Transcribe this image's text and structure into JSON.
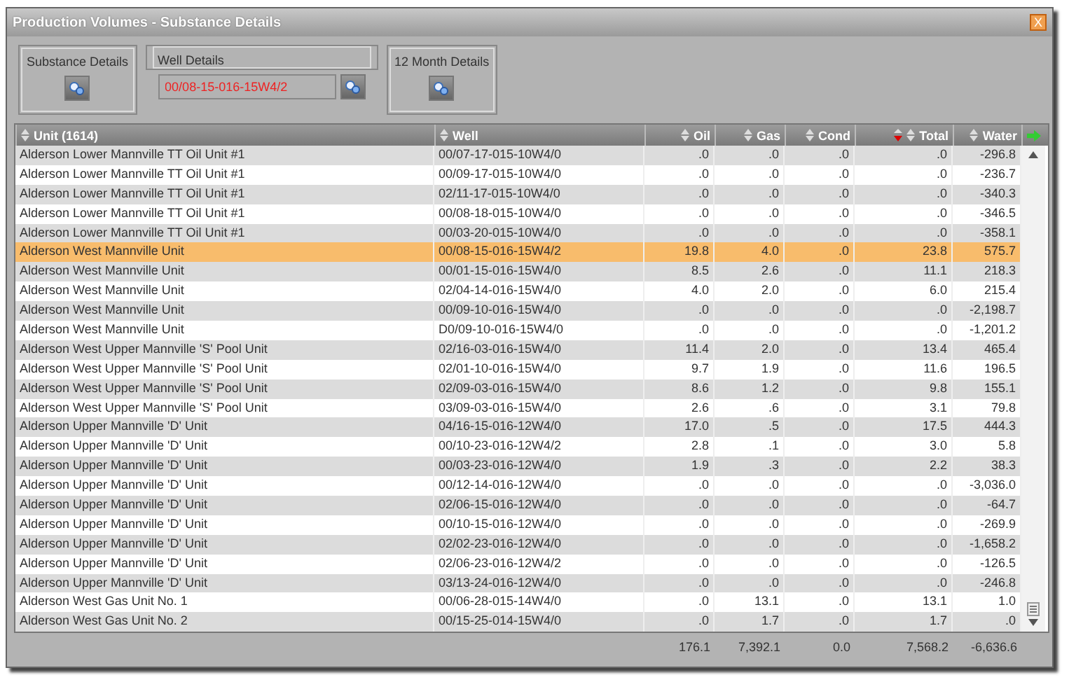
{
  "window": {
    "title": "Production Volumes - Substance Details",
    "close_label": "X"
  },
  "panels": [
    {
      "kind": "button",
      "title": "Substance Details"
    },
    {
      "kind": "field",
      "title": "Well Details",
      "value": "00/08-15-016-15W4/2"
    },
    {
      "kind": "button",
      "title": "12 Month Details"
    }
  ],
  "table": {
    "columns": [
      {
        "label": "Unit (1614)",
        "sorted": false
      },
      {
        "label": "Well",
        "sorted": false
      },
      {
        "label": "Oil",
        "sorted": false
      },
      {
        "label": "Gas",
        "sorted": false
      },
      {
        "label": "Cond",
        "sorted": false
      },
      {
        "label": "Total",
        "sorted": true
      },
      {
        "label": "Water",
        "sorted": false
      }
    ],
    "rows": [
      {
        "cells": [
          "Alderson Lower Mannville TT Oil Unit #1",
          "00/07-17-015-10W4/0",
          ".0",
          ".0",
          ".0",
          ".0",
          "-296.8"
        ],
        "selected": false
      },
      {
        "cells": [
          "Alderson Lower Mannville TT Oil Unit #1",
          "00/09-17-015-10W4/0",
          ".0",
          ".0",
          ".0",
          ".0",
          "-236.7"
        ],
        "selected": false
      },
      {
        "cells": [
          "Alderson Lower Mannville TT Oil Unit #1",
          "02/11-17-015-10W4/0",
          ".0",
          ".0",
          ".0",
          ".0",
          "-340.3"
        ],
        "selected": false
      },
      {
        "cells": [
          "Alderson Lower Mannville TT Oil Unit #1",
          "00/08-18-015-10W4/0",
          ".0",
          ".0",
          ".0",
          ".0",
          "-346.5"
        ],
        "selected": false
      },
      {
        "cells": [
          "Alderson Lower Mannville TT Oil Unit #1",
          "00/03-20-015-10W4/0",
          ".0",
          ".0",
          ".0",
          ".0",
          "-358.1"
        ],
        "selected": false
      },
      {
        "cells": [
          "Alderson West Mannville Unit",
          "00/08-15-016-15W4/2",
          "19.8",
          "4.0",
          ".0",
          "23.8",
          "575.7"
        ],
        "selected": true
      },
      {
        "cells": [
          "Alderson West Mannville Unit",
          "00/01-15-016-15W4/0",
          "8.5",
          "2.6",
          ".0",
          "11.1",
          "218.3"
        ],
        "selected": false
      },
      {
        "cells": [
          "Alderson West Mannville Unit",
          "02/04-14-016-15W4/0",
          "4.0",
          "2.0",
          ".0",
          "6.0",
          "215.4"
        ],
        "selected": false
      },
      {
        "cells": [
          "Alderson West Mannville Unit",
          "00/09-10-016-15W4/0",
          ".0",
          ".0",
          ".0",
          ".0",
          "-2,198.7"
        ],
        "selected": false
      },
      {
        "cells": [
          "Alderson West Mannville Unit",
          "D0/09-10-016-15W4/0",
          ".0",
          ".0",
          ".0",
          ".0",
          "-1,201.2"
        ],
        "selected": false
      },
      {
        "cells": [
          "Alderson West Upper Mannville 'S' Pool Unit",
          "02/16-03-016-15W4/0",
          "11.4",
          "2.0",
          ".0",
          "13.4",
          "465.4"
        ],
        "selected": false
      },
      {
        "cells": [
          "Alderson West Upper Mannville 'S' Pool Unit",
          "02/01-10-016-15W4/0",
          "9.7",
          "1.9",
          ".0",
          "11.6",
          "196.5"
        ],
        "selected": false
      },
      {
        "cells": [
          "Alderson West Upper Mannville 'S' Pool Unit",
          "02/09-03-016-15W4/0",
          "8.6",
          "1.2",
          ".0",
          "9.8",
          "155.1"
        ],
        "selected": false
      },
      {
        "cells": [
          "Alderson West Upper Mannville 'S' Pool Unit",
          "03/09-03-016-15W4/0",
          "2.6",
          ".6",
          ".0",
          "3.1",
          "79.8"
        ],
        "selected": false
      },
      {
        "cells": [
          "Alderson Upper Mannville 'D' Unit",
          "04/16-15-016-12W4/0",
          "17.0",
          ".5",
          ".0",
          "17.5",
          "444.3"
        ],
        "selected": false
      },
      {
        "cells": [
          "Alderson Upper Mannville 'D' Unit",
          "00/10-23-016-12W4/2",
          "2.8",
          ".1",
          ".0",
          "3.0",
          "5.8"
        ],
        "selected": false
      },
      {
        "cells": [
          "Alderson Upper Mannville 'D' Unit",
          "00/03-23-016-12W4/0",
          "1.9",
          ".3",
          ".0",
          "2.2",
          "38.3"
        ],
        "selected": false
      },
      {
        "cells": [
          "Alderson Upper Mannville 'D' Unit",
          "00/12-14-016-12W4/0",
          ".0",
          ".0",
          ".0",
          ".0",
          "-3,036.0"
        ],
        "selected": false
      },
      {
        "cells": [
          "Alderson Upper Mannville 'D' Unit",
          "02/06-15-016-12W4/0",
          ".0",
          ".0",
          ".0",
          ".0",
          "-64.7"
        ],
        "selected": false
      },
      {
        "cells": [
          "Alderson Upper Mannville 'D' Unit",
          "00/10-15-016-12W4/0",
          ".0",
          ".0",
          ".0",
          ".0",
          "-269.9"
        ],
        "selected": false
      },
      {
        "cells": [
          "Alderson Upper Mannville 'D' Unit",
          "02/02-23-016-12W4/0",
          ".0",
          ".0",
          ".0",
          ".0",
          "-1,658.2"
        ],
        "selected": false
      },
      {
        "cells": [
          "Alderson Upper Mannville 'D' Unit",
          "02/06-23-016-12W4/2",
          ".0",
          ".0",
          ".0",
          ".0",
          "-126.5"
        ],
        "selected": false
      },
      {
        "cells": [
          "Alderson Upper Mannville 'D' Unit",
          "03/13-24-016-12W4/0",
          ".0",
          ".0",
          ".0",
          ".0",
          "-246.8"
        ],
        "selected": false
      },
      {
        "cells": [
          "Alderson West Gas Unit No. 1",
          "00/06-28-015-14W4/0",
          ".0",
          "13.1",
          ".0",
          "13.1",
          "1.0"
        ],
        "selected": false
      },
      {
        "cells": [
          "Alderson West Gas Unit No. 2",
          "00/15-25-014-15W4/0",
          ".0",
          "1.7",
          ".0",
          "1.7",
          ".0"
        ],
        "selected": false
      }
    ],
    "totals": [
      "176.1",
      "7,392.1",
      "0.0",
      "7,568.2",
      "-6,636.6"
    ]
  }
}
